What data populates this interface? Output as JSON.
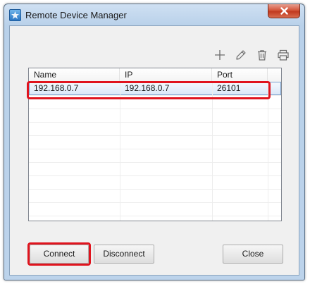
{
  "window": {
    "title": "Remote Device Manager",
    "icons": {
      "app": "app-icon",
      "close": "close-icon"
    }
  },
  "toolbar": {
    "icons": [
      "add-icon",
      "edit-icon",
      "delete-icon",
      "print-icon"
    ]
  },
  "table": {
    "columns": [
      "Name",
      "IP",
      "Port"
    ],
    "rows": [
      {
        "name": "192.168.0.7",
        "ip": "192.168.0.7",
        "port": "26101"
      }
    ]
  },
  "buttons": {
    "connect": "Connect",
    "disconnect": "Disconnect",
    "close": "Close"
  },
  "colors": {
    "highlight": "#e0141e",
    "selection": "#dbe8f8"
  }
}
